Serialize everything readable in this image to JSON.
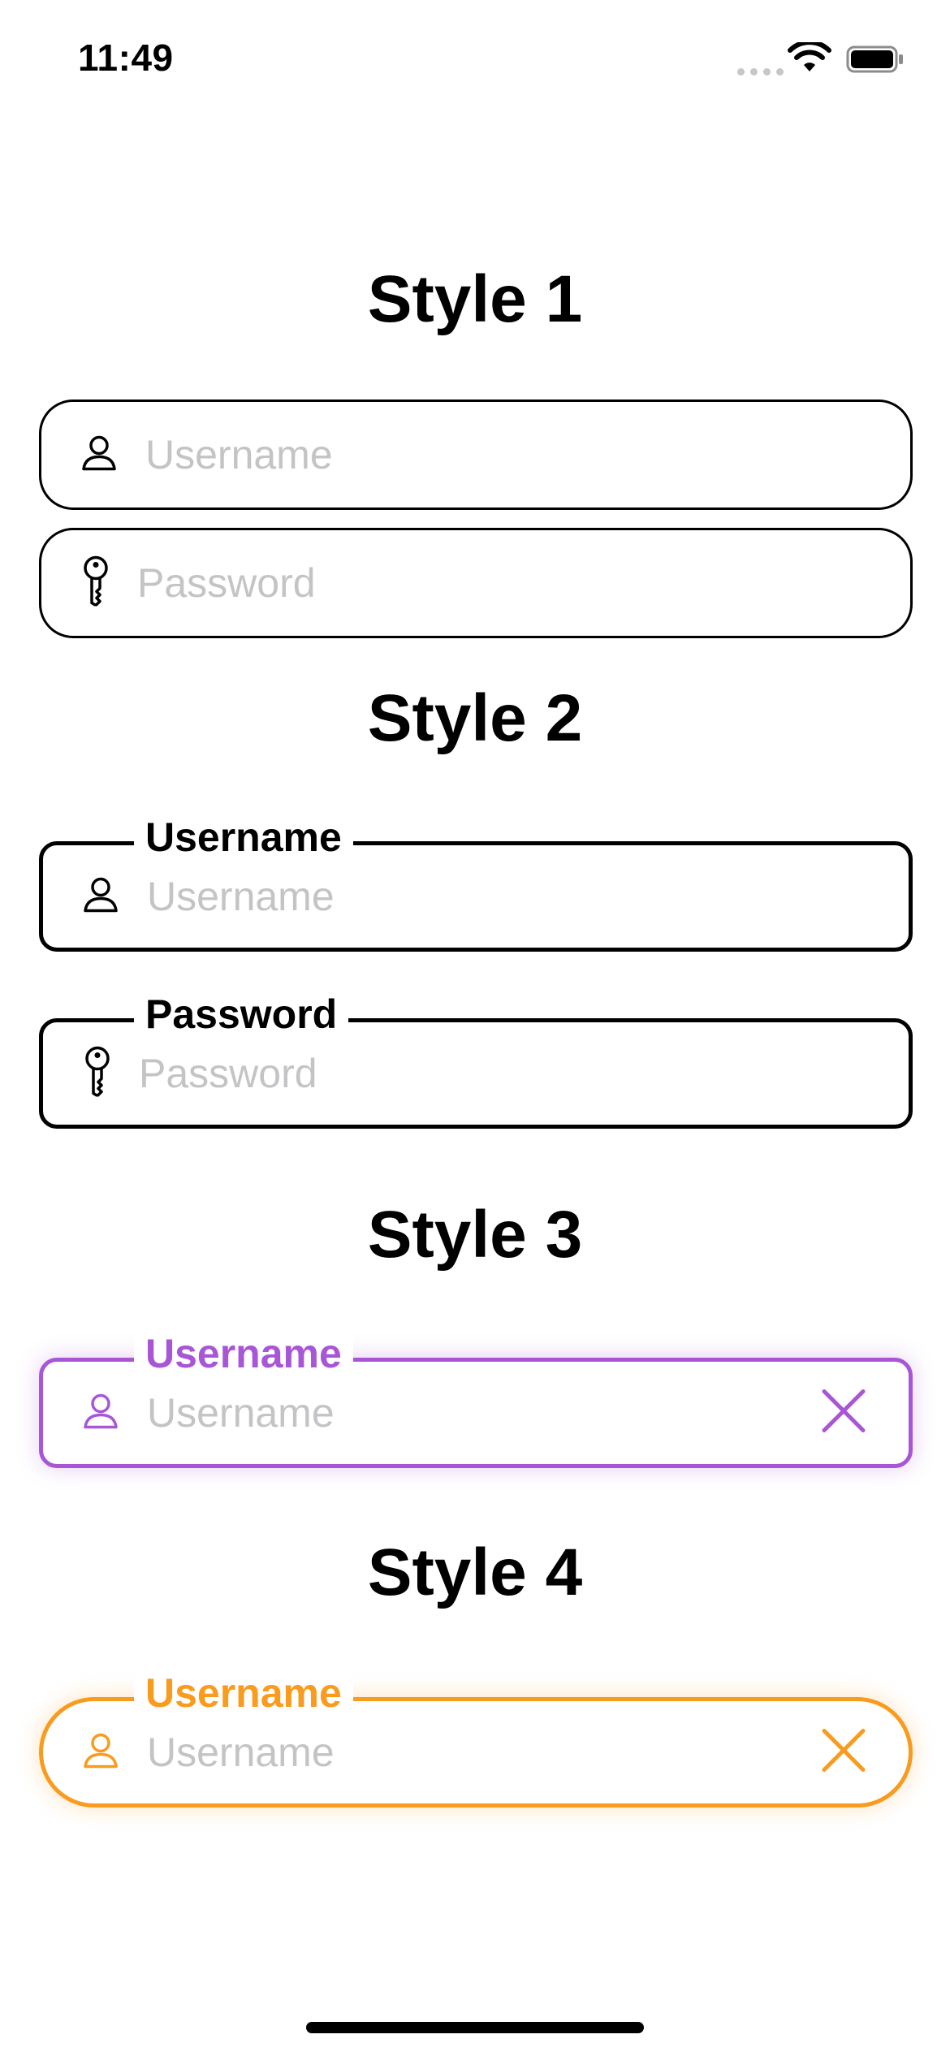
{
  "status_bar": {
    "time": "11:49"
  },
  "sections": [
    {
      "title": "Style 1",
      "fields": [
        {
          "placeholder": "Username",
          "icon": "person-icon"
        },
        {
          "placeholder": "Password",
          "icon": "key-icon"
        }
      ]
    },
    {
      "title": "Style 2",
      "fields": [
        {
          "label": "Username",
          "placeholder": "Username",
          "icon": "person-icon"
        },
        {
          "label": "Password",
          "placeholder": "Password",
          "icon": "key-icon"
        }
      ]
    },
    {
      "title": "Style 3",
      "accent": "#a856d6",
      "fields": [
        {
          "label": "Username",
          "placeholder": "Username",
          "icon": "person-icon",
          "clear_icon": "close-icon"
        }
      ]
    },
    {
      "title": "Style 4",
      "accent": "#f89b1e",
      "fields": [
        {
          "label": "Username",
          "placeholder": "Username",
          "icon": "person-icon",
          "clear_icon": "close-icon"
        }
      ]
    }
  ],
  "colors": {
    "placeholder": "#c4c4c6",
    "border": "#000000"
  }
}
